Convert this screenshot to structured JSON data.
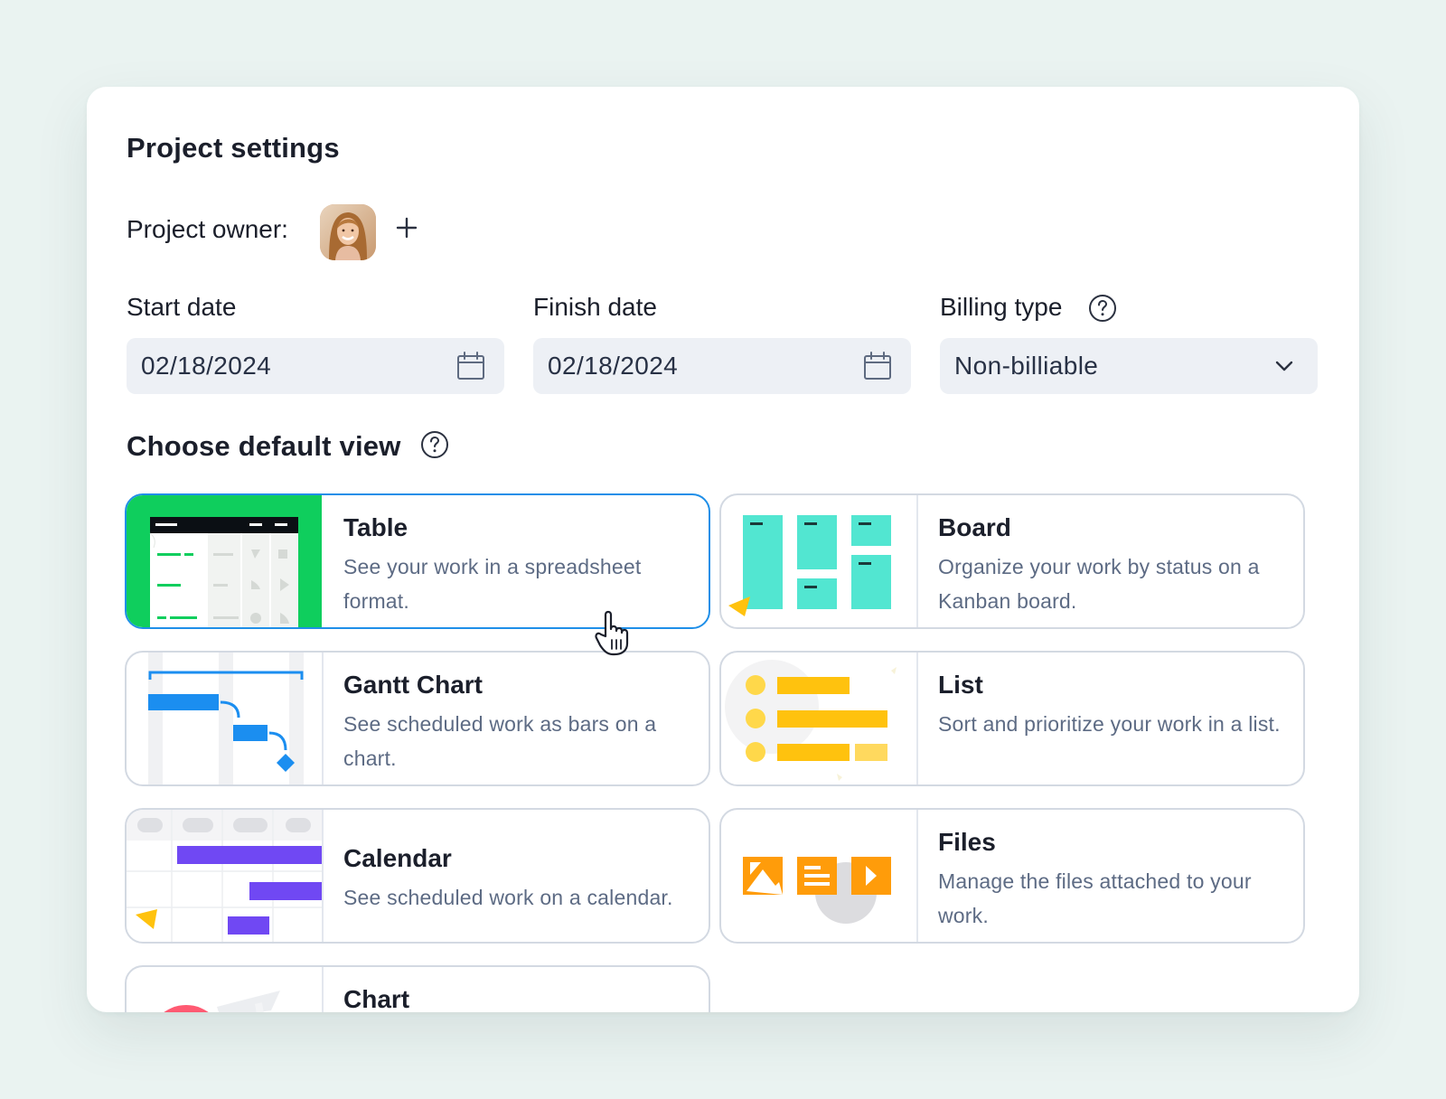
{
  "settings": {
    "title": "Project settings",
    "owner_label": "Project owner:",
    "owner_avatar_alt": "Project owner avatar",
    "start_date_label": "Start date",
    "start_date_value": "02/18/2024",
    "finish_date_label": "Finish date",
    "finish_date_value": "02/18/2024",
    "billing_type_label": "Billing type",
    "billing_type_value": "Non-billiable",
    "default_view_title": "Choose default view"
  },
  "views": [
    {
      "title": "Table",
      "desc": "See your work in a spreadsheet format.",
      "selected": true
    },
    {
      "title": "Board",
      "desc": "Organize your work by status on a Kanban board.",
      "selected": false
    },
    {
      "title": "Gantt Chart",
      "desc": "See scheduled work as bars on a chart.",
      "selected": false
    },
    {
      "title": "List",
      "desc": "Sort and prioritize your work in a list.",
      "selected": false
    },
    {
      "title": "Calendar",
      "desc": "See scheduled work on a calendar.",
      "selected": false
    },
    {
      "title": "Files",
      "desc": "Manage the files attached to your work.",
      "selected": false
    },
    {
      "title": "Chart",
      "desc": "",
      "selected": false
    }
  ],
  "colors": {
    "page_bg": "#eaf3f1",
    "selected_border": "#1f8fe8",
    "table_green": "#0fce5d",
    "board_teal": "#52e6d1",
    "gantt_blue": "#1b8ef0",
    "list_yellow": "#ffc20e",
    "calendar_purple": "#7048f3",
    "files_orange": "#ff9c0a"
  },
  "icons": {
    "add_owner": "plus-icon",
    "date": "calendar-icon",
    "dropdown": "chevron-down-icon",
    "help": "question-circle-icon",
    "cursor": "hand-pointer-icon"
  }
}
